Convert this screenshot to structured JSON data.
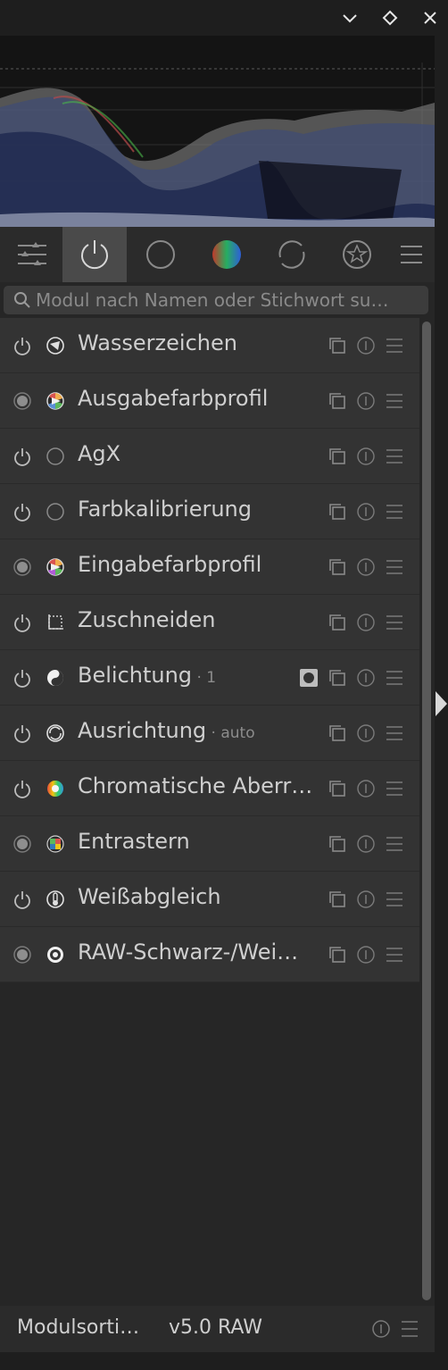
{
  "colors": {
    "accent": "#4a4a4a",
    "panel": "#333333",
    "text": "#cfcfcf",
    "muted": "#8c8c8c"
  },
  "window_controls": [
    {
      "name": "minimize-button",
      "icon": "chevron-down-icon"
    },
    {
      "name": "maximize-button",
      "icon": "diamond-icon"
    },
    {
      "name": "close-button",
      "icon": "close-icon"
    }
  ],
  "tabs": [
    {
      "name": "tab-quick-access",
      "icon": "sliders-icon"
    },
    {
      "name": "tab-active-modules",
      "icon": "power-icon",
      "active": true
    },
    {
      "name": "tab-base",
      "icon": "circle-icon"
    },
    {
      "name": "tab-color",
      "icon": "color-ball-icon"
    },
    {
      "name": "tab-correct",
      "icon": "circular-arrows-icon"
    },
    {
      "name": "tab-effects",
      "icon": "stars-icon"
    },
    {
      "name": "tab-presets-menu",
      "icon": "hamburger-icon"
    }
  ],
  "search": {
    "placeholder": "Modul nach Namen oder Stichwort su…",
    "value": ""
  },
  "modules": [
    {
      "label": "Wasserzeichen",
      "sub": "",
      "power": "off",
      "icon": "watermark-icon",
      "mask": false
    },
    {
      "label": "Ausgabefarbprofil",
      "sub": "",
      "power": "always-on",
      "icon": "output-profile-icon",
      "mask": false
    },
    {
      "label": "AgX",
      "sub": "",
      "power": "off",
      "icon": "agx-circle-icon",
      "mask": false
    },
    {
      "label": "Farbkalibrierung",
      "sub": "",
      "power": "off",
      "icon": "color-calibration-circle-icon",
      "mask": false
    },
    {
      "label": "Eingabefarbprofil",
      "sub": "",
      "power": "always-on",
      "icon": "input-profile-icon",
      "mask": false
    },
    {
      "label": "Zuschneiden",
      "sub": "",
      "power": "off",
      "icon": "crop-icon",
      "mask": false
    },
    {
      "label": "Belichtung",
      "sub": "1",
      "power": "off",
      "icon": "exposure-icon",
      "mask": true
    },
    {
      "label": "Ausrichtung",
      "sub": "auto",
      "power": "off",
      "icon": "orientation-icon",
      "mask": false
    },
    {
      "label": "Chromatische Aberr…",
      "sub": "",
      "power": "off",
      "icon": "chromatic-aberration-icon",
      "mask": false
    },
    {
      "label": "Entrastern",
      "sub": "",
      "power": "always-on",
      "icon": "demosaic-icon",
      "mask": false
    },
    {
      "label": "Weißabgleich",
      "sub": "",
      "power": "off",
      "icon": "white-balance-icon",
      "mask": false
    },
    {
      "label": "RAW-Schwarz-/Wei…",
      "sub": "",
      "power": "always-on",
      "icon": "raw-black-white-icon",
      "mask": false
    }
  ],
  "footer": {
    "label": "Modulsorti…",
    "value": "v5.0 RAW"
  }
}
